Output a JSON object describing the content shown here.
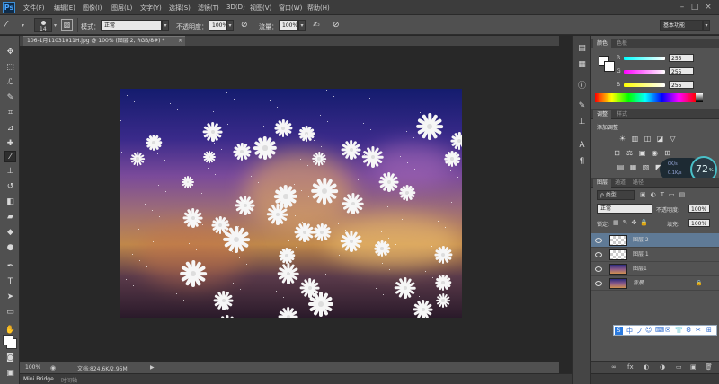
{
  "app": {
    "logo": "Ps"
  },
  "menubar": {
    "items": [
      "文件(F)",
      "编辑(E)",
      "图像(I)",
      "图层(L)",
      "文字(Y)",
      "选择(S)",
      "滤镜(T)",
      "3D(D)",
      "视图(V)",
      "窗口(W)",
      "帮助(H)"
    ],
    "window_buttons": [
      "–",
      "□",
      "×"
    ]
  },
  "options": {
    "brush_size": "14",
    "mode_label": "模式：",
    "mode_value": "正常",
    "opacity_label": "不透明度：",
    "opacity_value": "100%",
    "flow_label": "流量：",
    "flow_value": "100%",
    "workspace": "基本功能"
  },
  "document": {
    "tab_title": "106-1月11031011H.jpg @ 100% (图层 2, RGB/8#) *",
    "tab_close": "×"
  },
  "status": {
    "zoom": "100%",
    "doc_label": "文档:824.6K/2.95M"
  },
  "bottom_tabs": {
    "mini_bridge": "Mini Bridge",
    "timeline": "时间轴"
  },
  "color_panel": {
    "tabs": [
      "颜色",
      "色板"
    ],
    "channels": [
      {
        "label": "R",
        "value": "255",
        "color": "#e03030"
      },
      {
        "label": "G",
        "value": "255",
        "color": "#30c030"
      },
      {
        "label": "B",
        "value": "255",
        "color": "#3050e0"
      }
    ]
  },
  "adjust_panel": {
    "tabs": [
      "调整",
      "样式"
    ],
    "title": "添加调整",
    "row1_icons": [
      "☀",
      "▥",
      "◫",
      "◪",
      "▽"
    ],
    "row2_icons": [
      "⊟",
      "⚖",
      "▣",
      "◉",
      "⊞"
    ],
    "row3_icons": [
      "▤",
      "▦",
      "▧",
      "◩",
      "◨"
    ]
  },
  "network_widget": {
    "up": "0K/s",
    "down": "0.1K/s",
    "percent": "72",
    "percent_unit": "%"
  },
  "layers_panel": {
    "tabs": [
      "图层",
      "通道",
      "路径"
    ],
    "filter_label": "ρ 类型",
    "blend_mode": "正常",
    "opacity_label": "不透明度:",
    "opacity_value": "100%",
    "lock_label": "锁定:",
    "fill_label": "填充:",
    "fill_value": "100%",
    "layers": [
      {
        "name": "图层 2",
        "selected": true,
        "thumb": "checker"
      },
      {
        "name": "图层 1",
        "selected": false,
        "thumb": "checker"
      },
      {
        "name": "图层1",
        "selected": false,
        "thumb": "photo"
      },
      {
        "name": "背景",
        "selected": false,
        "thumb": "photo",
        "locked": true
      }
    ],
    "footer_icons": [
      "∞",
      "fx",
      "◐",
      "◑",
      "▭",
      "▣",
      "🗑"
    ]
  },
  "ime_toolbar": {
    "items": [
      "S",
      "中",
      "ノ",
      "☺",
      "⌨",
      "✉",
      "👕",
      "⚙",
      "✂",
      "⊞"
    ]
  }
}
